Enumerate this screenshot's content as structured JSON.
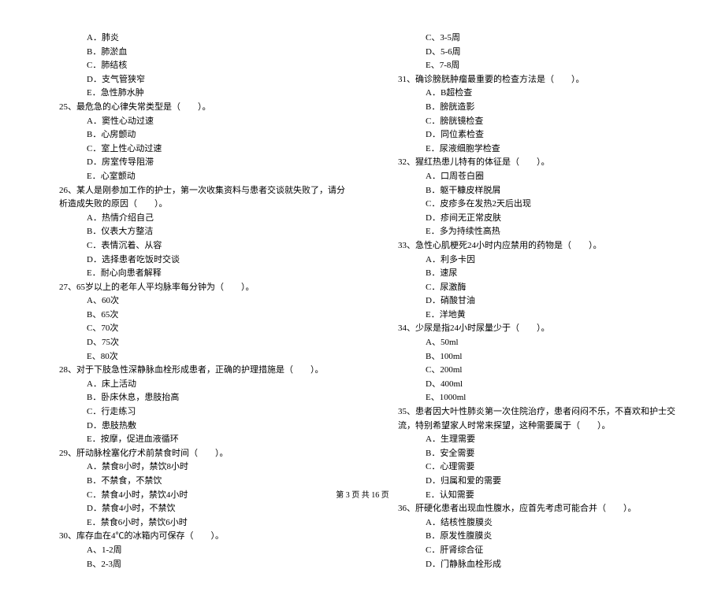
{
  "left": {
    "opts24": [
      "A．肺炎",
      "B．肺淤血",
      "C．肺结核",
      "D．支气管狭窄",
      "E．急性肺水肿"
    ],
    "q25": "25、最危急的心律失常类型是（　　）。",
    "opts25": [
      "A．窦性心动过速",
      "B．心房颤动",
      "C．室上性心动过速",
      "D．房室传导阻滞",
      "E．心室颤动"
    ],
    "q26": "26、某人是刚参加工作的护士，第一次收集资料与患者交谈就失败了，请分析造成失败的原因（　　）。",
    "opts26": [
      "A．热情介绍自己",
      "B．仪表大方整洁",
      "C．表情沉着、从容",
      "D．选择患者吃饭时交谈",
      "E．耐心向患者解释"
    ],
    "q27": "27、65岁以上的老年人平均脉率每分钟为（　　）。",
    "opts27": [
      "A、60次",
      "B、65次",
      "C、70次",
      "D、75次",
      "E、80次"
    ],
    "q28": "28、对于下肢急性深静脉血栓形成患者，正确的护理措施是（　　）。",
    "opts28": [
      "A．床上活动",
      "B．卧床休息，患肢抬高",
      "C．行走练习",
      "D．患肢热敷",
      "E．按摩，促进血液循环"
    ],
    "q29": "29、肝动脉栓塞化疗术前禁食时间（　　）。",
    "opts29": [
      "A．禁食8小时，禁饮8小时",
      "B．不禁食，不禁饮",
      "C．禁食4小时，禁饮4小时",
      "D．禁食4小时，不禁饮",
      "E．禁食6小时，禁饮6小时"
    ],
    "q30": "30、库存血在4℃的冰箱内可保存（　　）。",
    "opts30": [
      "A、1-2周",
      "B、2-3周"
    ]
  },
  "right": {
    "opts30b": [
      "C、3-5周",
      "D、5-6周",
      "E、7-8周"
    ],
    "q31": "31、确诊膀胱肿瘤最重要的检查方法是（　　）。",
    "opts31": [
      "A．B超检查",
      "B．膀胱造影",
      "C．膀胱镜检查",
      "D．同位素检查",
      "E．尿液细胞学检查"
    ],
    "q32": "32、猩红热患儿特有的体征是（　　）。",
    "opts32": [
      "A．口周苍白圈",
      "B．躯干糠皮样脱屑",
      "C．皮疹多在发热2天后出现",
      "D．疹间无正常皮肤",
      "E．多为持续性高热"
    ],
    "q33": "33、急性心肌梗死24小时内应禁用的药物是（　　）。",
    "opts33": [
      "A．利多卡因",
      "B．速尿",
      "C．尿激酶",
      "D．硝酸甘油",
      "E．洋地黄"
    ],
    "q34": "34、少尿是指24小时尿量少于（　　）。",
    "opts34": [
      "A、50ml",
      "B、100ml",
      "C、200ml",
      "D、400ml",
      "E、1000ml"
    ],
    "q35": "35、患者因大叶性肺炎第一次住院治疗，患者闷闷不乐，不喜欢和护士交流，特别希望家人时常来探望，这种需要属于（　　）。",
    "opts35": [
      "A．生理需要",
      "B．安全需要",
      "C．心理需要",
      "D．归属和爱的需要",
      "E．认知需要"
    ],
    "q36": "36、肝硬化患者出现血性腹水，应首先考虑可能合并（　　）。",
    "opts36": [
      "A．结核性腹膜炎",
      "B．原发性腹膜炎",
      "C．肝肾综合征",
      "D．门静脉血栓形成"
    ]
  },
  "footer": "第 3 页 共 16 页"
}
